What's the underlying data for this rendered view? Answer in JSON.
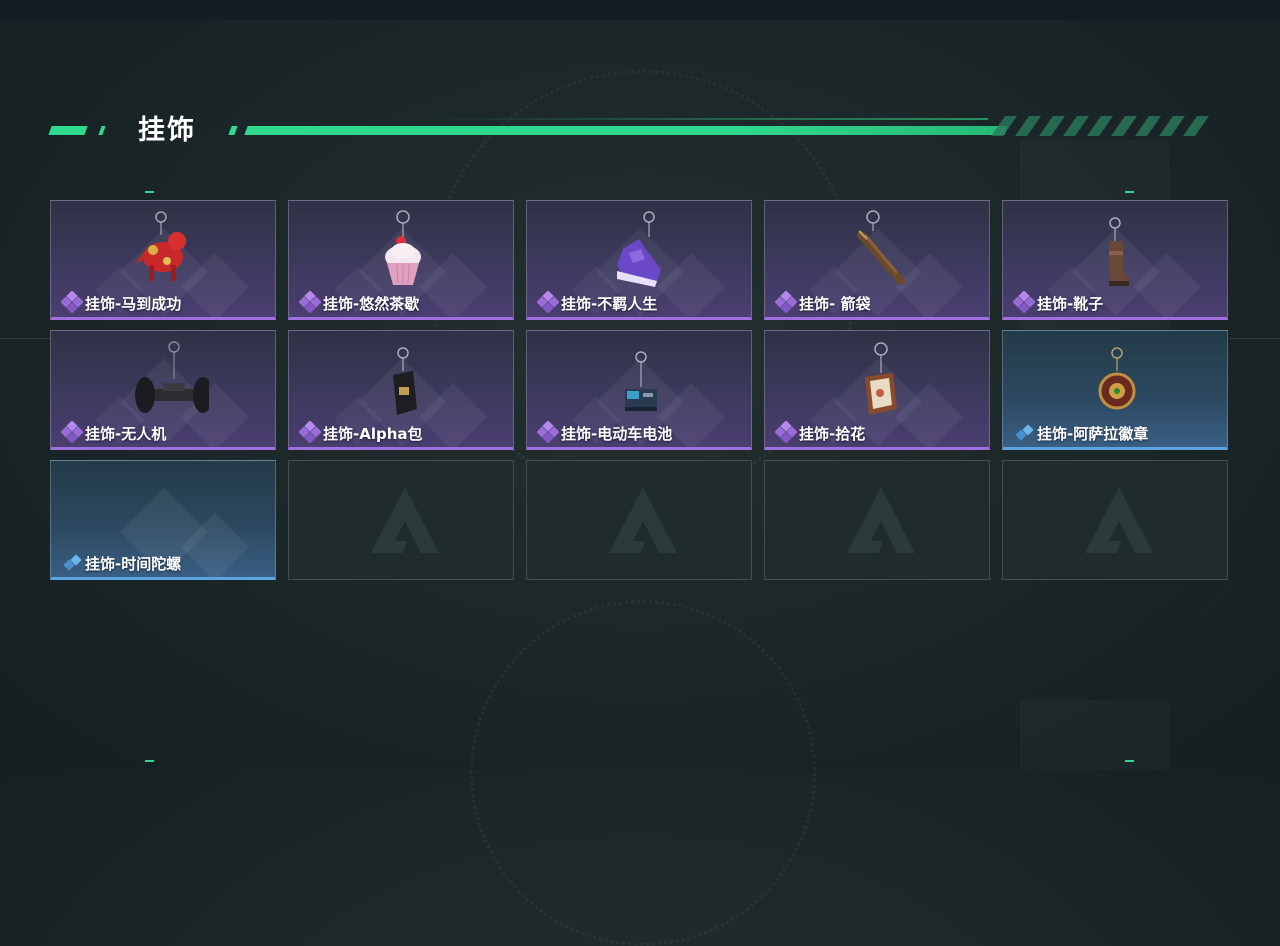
{
  "section": {
    "title": "挂饰"
  },
  "colors": {
    "accent": "#2fd98e",
    "purple_rarity": "#a070e0",
    "blue_rarity": "#5ca4e0"
  },
  "items": [
    {
      "label": "挂饰-马到成功",
      "rarity": "purple",
      "icon": "red-horse-charm-icon"
    },
    {
      "label": "挂饰-悠然茶歇",
      "rarity": "purple",
      "icon": "cupcake-charm-icon"
    },
    {
      "label": "挂饰-不羁人生",
      "rarity": "purple",
      "icon": "sneaker-charm-icon"
    },
    {
      "label": "挂饰- 箭袋",
      "rarity": "purple",
      "icon": "quiver-charm-icon"
    },
    {
      "label": "挂饰-靴子",
      "rarity": "purple",
      "icon": "boot-charm-icon"
    },
    {
      "label": "挂饰-无人机",
      "rarity": "purple",
      "icon": "drone-charm-icon"
    },
    {
      "label": "挂饰-Alpha包",
      "rarity": "purple",
      "icon": "alpha-bag-charm-icon"
    },
    {
      "label": "挂饰-电动车电池",
      "rarity": "purple",
      "icon": "battery-charm-icon"
    },
    {
      "label": "挂饰-拾花",
      "rarity": "purple",
      "icon": "flower-frame-charm-icon"
    },
    {
      "label": "挂饰-阿萨拉徽章",
      "rarity": "blue",
      "icon": "badge-charm-icon"
    },
    {
      "label": "挂饰-时间陀螺",
      "rarity": "blue",
      "icon": ""
    }
  ],
  "empty_slots": 4
}
